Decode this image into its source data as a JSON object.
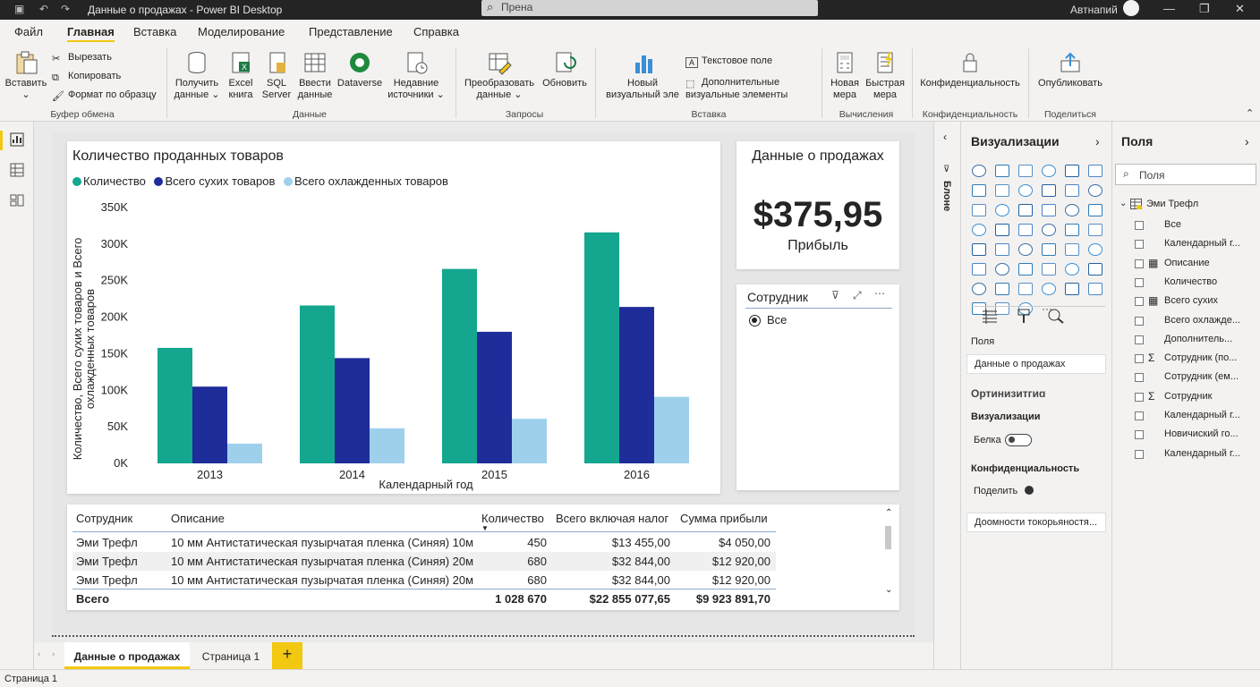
{
  "titlebar": {
    "title": "Данные о продажах - Power BI Desktop",
    "search": "Прена",
    "user": "Автнапий",
    "min": "—",
    "max": "❐",
    "close": "✕"
  },
  "menu": {
    "items": [
      "Файл",
      "Главная",
      "Вставка",
      "Моделирование",
      "Представление",
      "Справка"
    ]
  },
  "ribbon": {
    "paste": "Вставить",
    "cut": "Вырезать",
    "copy": "Копировать",
    "format": "Формат по образцу",
    "clipboard_group": "Буфер обмена",
    "get_data": "Получить данные",
    "excel": "Excel книга",
    "sql": "SQL Server",
    "enter_data": "Ввести данные",
    "dataverse": "Dataverse",
    "recent": "Недавние источники",
    "data_group": "Данные",
    "transform": "Преобразовать данные",
    "refresh": "Обновить",
    "queries_group": "Запросы",
    "new_visual": "Новый визуальный эле",
    "text_box": "Текстовое поле",
    "more_visuals": "Дополнительные визуальные элементы",
    "insert_group": "Вставка",
    "new_measure": "Новая мера",
    "quick_measure": "Быстрая мера",
    "calc_group": "Вычисления",
    "sensitivity": "Конфиденциальность",
    "sens_group": "Конфиденциальность",
    "publish": "Опубликовать",
    "share_group": "Поделиться"
  },
  "chart": {
    "title": "Количество проданных товаров",
    "xlabel": "Календарный год",
    "ylabel_line1": "Количество, Всего сухих товаров и Всего",
    "ylabel_line2": "охлажденных товаров"
  },
  "chart_data": {
    "type": "bar",
    "title": "Количество проданных товаров",
    "xlabel": "Календарный год",
    "ylabel": "Количество, Всего сухих товаров и Всего охлажденных товаров",
    "categories": [
      "2013",
      "2014",
      "2015",
      "2016"
    ],
    "series": [
      {
        "name": "Количество",
        "color": "#14a68e",
        "values": [
          158000,
          216000,
          266000,
          316000
        ]
      },
      {
        "name": "Всего сухих товаров",
        "color": "#1e2d9a",
        "values": [
          105000,
          144000,
          180000,
          214000
        ]
      },
      {
        "name": "Всего охлажденных товаров",
        "color": "#9ed0ec",
        "values": [
          27000,
          48000,
          61000,
          91000
        ]
      }
    ],
    "ylim": [
      0,
      350000
    ],
    "yticks": [
      "0K",
      "50K",
      "100K",
      "150K",
      "200K",
      "250K",
      "300K",
      "350K"
    ],
    "legend": "top-left",
    "grid": false
  },
  "kpi": {
    "title": "Данные о продажах",
    "value": "$375,95",
    "label": "Прибыль"
  },
  "slicer": {
    "title": "Сотрудник",
    "option": "Все"
  },
  "table": {
    "headers": [
      "Сотрудник",
      "Описание",
      "Количество",
      "Всего включая налог",
      "Сумма прибыли"
    ],
    "rows": [
      [
        "Эми Трефл",
        "10 мм Антистатическая пузырчатая пленка (Синяя) 10м",
        "450",
        "$13 455,00",
        "$4 050,00"
      ],
      [
        "Эми Трефл",
        "10 мм Антистатическая пузырчатая пленка (Синяя) 20м",
        "680",
        "$32 844,00",
        "$12 920,00"
      ],
      [
        "Эми Трефл",
        "10 мм Антистатическая пузырчатая пленка (Синяя) 20м",
        "680",
        "$32 844,00",
        "$12 920,00"
      ]
    ],
    "total": [
      "Всего",
      "",
      "1 028 670",
      "$22 855 077,65",
      "$9 923 891,70"
    ]
  },
  "tabs": {
    "active": "Данные о продажах",
    "other": "Страница 1",
    "add": "+"
  },
  "status": "Страница 1",
  "viz": {
    "title": "Визуализации",
    "filters_label": "Блоне",
    "fields_label": "Поля",
    "well": "Данные о продажах",
    "opt": "Ортинизитгиɑ",
    "vis_label": "Визуализации",
    "toggle_label": "Белка",
    "conf": "Конфиденциальность",
    "share": "Поделить",
    "link": "Доомности токорьяностя..."
  },
  "fields": {
    "title": "Поля",
    "search": "Поля",
    "table": "Эми Трефл",
    "items": [
      "Все",
      "Календарный г...",
      "Описание",
      "Количество",
      "Всего сухих",
      "Всего охлажде...",
      "Дополнитель...",
      "Сотрудник (по...",
      "Сотрудник (ем...",
      "Сотрудник",
      "Календарный г...",
      "Новичиский го...",
      "Календарный г..."
    ]
  }
}
